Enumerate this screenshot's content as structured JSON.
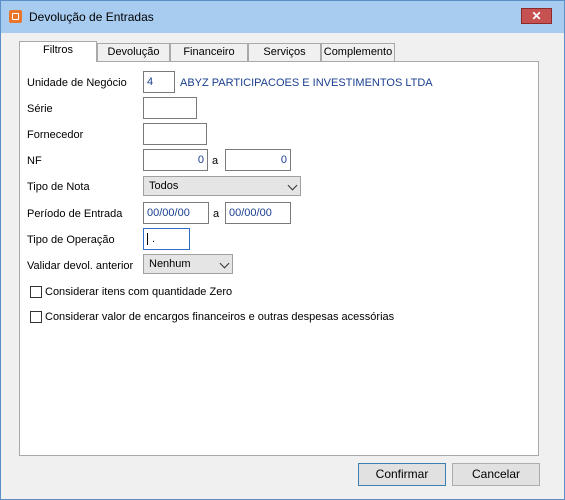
{
  "window": {
    "title": "Devolução de Entradas",
    "close_label": "✕"
  },
  "tabs": [
    "Filtros",
    "Devolução",
    "Financeiro",
    "Serviços",
    "Complemento"
  ],
  "form": {
    "unidade_label": "Unidade de Negócio",
    "unidade_code": "4",
    "unidade_name": "ABYZ PARTICIPACOES E INVESTIMENTOS LTDA",
    "serie_label": "Série",
    "serie_value": "",
    "fornecedor_label": "Fornecedor",
    "fornecedor_value": "",
    "nf_label": "NF",
    "nf_from": "0",
    "nf_to": "0",
    "range_sep": "a",
    "tipo_nota_label": "Tipo de Nota",
    "tipo_nota_value": "Todos",
    "periodo_label": "Período de Entrada",
    "periodo_from": "00/00/00",
    "periodo_to": "00/00/00",
    "tipo_operacao_label": "Tipo de Operação",
    "tipo_operacao_value": ".",
    "validar_label": "Validar devol. anterior",
    "validar_value": "Nenhum",
    "check1_label": "Considerar itens com quantidade Zero",
    "check2_label": "Considerar valor de encargos financeiros e outras despesas acessórias"
  },
  "buttons": {
    "confirm": "Confirmar",
    "cancel": "Cancelar"
  }
}
